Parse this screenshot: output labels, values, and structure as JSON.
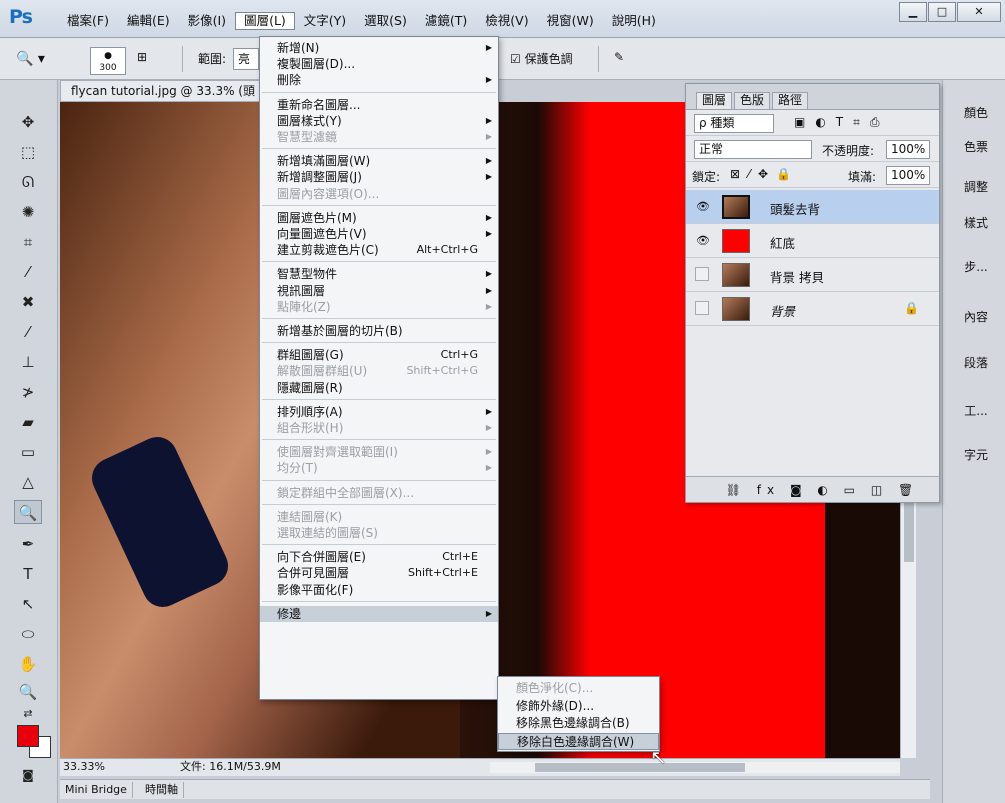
{
  "app": {
    "logo": "Ps"
  },
  "menubar": {
    "items": [
      "檔案(F)",
      "編輯(E)",
      "影像(I)",
      "圖層(L)",
      "文字(Y)",
      "選取(S)",
      "濾鏡(T)",
      "檢視(V)",
      "視窗(W)",
      "說明(H)"
    ],
    "window_buttons": [
      "▁",
      "□",
      "✕"
    ]
  },
  "optbar": {
    "brush_size": "300",
    "range_label": "範圍:",
    "range_value": "亮",
    "protect_tones": "☑ 保護色調"
  },
  "document": {
    "tab_title": "flycan tutorial.jpg @ 33.3% (頭",
    "zoom": "33.33%",
    "file_info": "文件: 16.1M/53.9M"
  },
  "bottom_tabs": [
    "Mini Bridge",
    "時間軸"
  ],
  "layer_menu": {
    "items": [
      {
        "label": "新增(N)",
        "arrow": true
      },
      {
        "label": "複製圖層(D)..."
      },
      {
        "label": "刪除",
        "arrow": true
      },
      {
        "label": "重新命名圖層..."
      },
      {
        "label": "圖層樣式(Y)",
        "arrow": true
      },
      {
        "label": "智慧型濾鏡",
        "arrow": true,
        "disabled": true
      },
      {
        "label": "新增填滿圖層(W)",
        "arrow": true
      },
      {
        "label": "新增調整圖層(J)",
        "arrow": true
      },
      {
        "label": "圖層內容選項(O)...",
        "disabled": true
      },
      {
        "label": "圖層遮色片(M)",
        "arrow": true
      },
      {
        "label": "向量圖遮色片(V)",
        "arrow": true
      },
      {
        "label": "建立剪裁遮色片(C)",
        "shortcut": "Alt+Ctrl+G"
      },
      {
        "label": "智慧型物件",
        "arrow": true
      },
      {
        "label": "視訊圖層",
        "arrow": true
      },
      {
        "label": "點陣化(Z)",
        "arrow": true,
        "disabled": true
      },
      {
        "label": "新增基於圖層的切片(B)"
      },
      {
        "label": "群組圖層(G)",
        "shortcut": "Ctrl+G"
      },
      {
        "label": "解散圖層群組(U)",
        "shortcut": "Shift+Ctrl+G",
        "disabled": true
      },
      {
        "label": "隱藏圖層(R)"
      },
      {
        "label": "排列順序(A)",
        "arrow": true
      },
      {
        "label": "組合形狀(H)",
        "arrow": true,
        "disabled": true
      },
      {
        "label": "使圖層對齊選取範圍(I)",
        "arrow": true,
        "disabled": true
      },
      {
        "label": "均分(T)",
        "arrow": true,
        "disabled": true
      },
      {
        "label": "鎖定群組中全部圖層(X)...",
        "disabled": true
      },
      {
        "label": "連結圖層(K)",
        "disabled": true
      },
      {
        "label": "選取連結的圖層(S)",
        "disabled": true
      },
      {
        "label": "向下合併圖層(E)",
        "shortcut": "Ctrl+E"
      },
      {
        "label": "合併可見圖層",
        "shortcut": "Shift+Ctrl+E"
      },
      {
        "label": "影像平面化(F)"
      },
      {
        "label": "修邊",
        "arrow": true,
        "hover": true
      }
    ]
  },
  "matting_submenu": {
    "items": [
      {
        "label": "顏色淨化(C)...",
        "disabled": true
      },
      {
        "label": "修飾外緣(D)..."
      },
      {
        "label": "移除黑色邊緣調合(B)"
      },
      {
        "label": "移除白色邊緣調合(W)",
        "hover": true
      }
    ]
  },
  "layers_panel": {
    "tabs": [
      "圖層",
      "色版",
      "路徑"
    ],
    "filter_kind": "ρ 種類",
    "blend_mode": "正常",
    "opacity_label": "不透明度:",
    "opacity_value": "100%",
    "lock_label": "鎖定:",
    "fill_label": "填滿:",
    "fill_value": "100%",
    "layers": [
      {
        "name": "頭髮去背",
        "visible": true,
        "selected": true
      },
      {
        "name": "紅底",
        "visible": true
      },
      {
        "name": "背景 拷貝",
        "visible": false
      },
      {
        "name": "背景",
        "visible": false,
        "italic": true,
        "locked": true
      }
    ],
    "footer_icons": "⛓ fx ◙ ◐ ▭ ◫ 🗑"
  },
  "dock": {
    "items": [
      "顏色",
      "色票",
      "調整",
      "樣式",
      "步...",
      "內容",
      "段落",
      "工...",
      "字元"
    ]
  },
  "colors": {
    "foreground": "#e8000d",
    "background": "#ffffff",
    "canvas_red": "#ff0000"
  }
}
